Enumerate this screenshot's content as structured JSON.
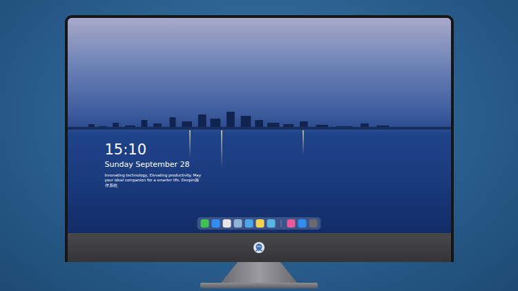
{
  "lock_screen": {
    "time": "15:10",
    "date": "Sunday September 28",
    "tagline": "Innovating technology, Elevating productivity. May your ideal companion for a smarter life. Deepin操作系统"
  },
  "dock": {
    "apps": [
      {
        "color": "#3fc24f"
      },
      {
        "color": "#2f8ef0"
      },
      {
        "color": "#e6e6e6"
      },
      {
        "color": "#8fb4d6"
      },
      {
        "color": "#4aa8e8"
      },
      {
        "color": "#f3d250"
      },
      {
        "color": "#5ab4e4"
      }
    ],
    "tray": [
      {
        "color": "#e85a9a"
      },
      {
        "color": "#2f8ef0"
      },
      {
        "color": "#6a6a70"
      }
    ]
  }
}
